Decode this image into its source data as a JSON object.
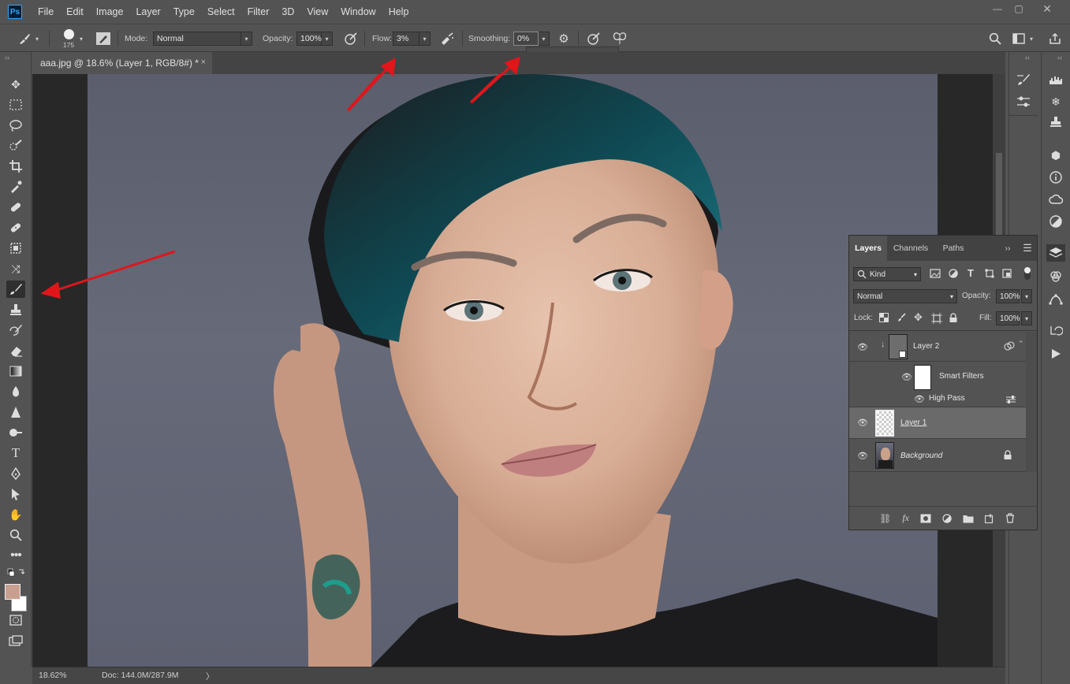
{
  "app": {
    "logo": "Ps"
  },
  "menu": [
    "File",
    "Edit",
    "Image",
    "Layer",
    "Type",
    "Select",
    "Filter",
    "3D",
    "View",
    "Window",
    "Help"
  ],
  "options": {
    "brush_size": "175",
    "mode_label": "Mode:",
    "mode_value": "Normal",
    "opacity_label": "Opacity:",
    "opacity_value": "100%",
    "flow_label": "Flow:",
    "flow_value": "3%",
    "smoothing_label": "Smoothing:",
    "smoothing_value": "0%",
    "smoothing_slider": 0
  },
  "document": {
    "tab_title": "aaa.jpg @ 18.6% (Layer 1, RGB/8#) *",
    "close": "×"
  },
  "status": {
    "zoom": "18.62%",
    "doc_info": "Doc: 144.0M/287.9M",
    "arrow": "〉"
  },
  "layers_panel": {
    "tabs": [
      "Layers",
      "Channels",
      "Paths"
    ],
    "filter_kind": "Kind",
    "blend_mode": "Normal",
    "opacity_label": "Opacity:",
    "opacity_value": "100%",
    "lock_label": "Lock:",
    "fill_label": "Fill:",
    "fill_value": "100%",
    "layers": [
      {
        "name": "Layer 2",
        "type": "smart-object",
        "clipped": true
      },
      {
        "name": "Smart Filters",
        "type": "smart-filters"
      },
      {
        "name": "High Pass",
        "type": "filter"
      },
      {
        "name": "Layer 1",
        "type": "pixel",
        "selected": true
      },
      {
        "name": "Background",
        "type": "background",
        "locked": true
      }
    ]
  },
  "colors": {
    "foreground": "#c9a08f",
    "background": "#ffffff",
    "annotation_arrow": "#e0161b",
    "ui_bg": "#535353"
  },
  "icons": {
    "toolbar": [
      "move-icon",
      "marquee-icon",
      "lasso-icon",
      "quick-selection-icon",
      "crop-icon",
      "eyedropper-icon",
      "spot-healing-icon",
      "healing-icon",
      "patch-icon",
      "content-aware-move-icon",
      "brush-icon",
      "stamp-icon",
      "history-brush-icon",
      "eraser-icon",
      "gradient-icon",
      "blur-icon",
      "sharpen-icon",
      "dodge-icon",
      "type-icon",
      "pen-icon",
      "path-selection-icon",
      "hand-icon",
      "zoom-icon",
      "more-icon",
      "edit-quick-mask-icon",
      "screen-mode-icon"
    ]
  }
}
